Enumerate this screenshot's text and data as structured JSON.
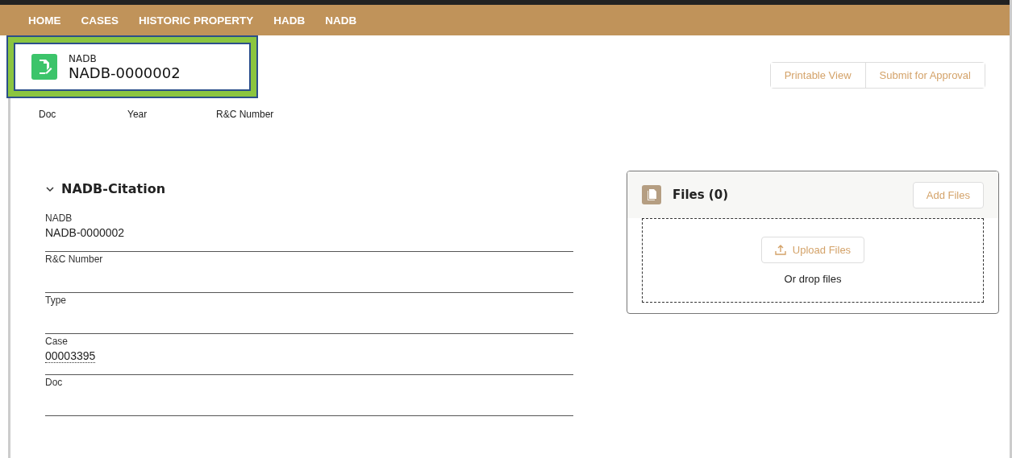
{
  "nav": {
    "items": [
      {
        "label": "HOME"
      },
      {
        "label": "CASES"
      },
      {
        "label": "HISTORIC PROPERTY"
      },
      {
        "label": "HADB"
      },
      {
        "label": "NADB"
      }
    ]
  },
  "record": {
    "object": "NADB",
    "title": "NADB-0000002",
    "highlighted": true
  },
  "actions": [
    "Printable View",
    "Submit for Approval"
  ],
  "highlights": [
    "Doc",
    "Year",
    "R&C Number"
  ],
  "section": {
    "title": "NADB-Citation",
    "expanded": true,
    "fields": [
      {
        "label": "NADB",
        "value": "NADB-0000002",
        "kind": "text"
      },
      {
        "label": "R&C Number"
      },
      {
        "label": "Type"
      },
      {
        "label": "Case",
        "value": "00003395",
        "kind": "link"
      },
      {
        "label": "Doc"
      }
    ]
  },
  "files": {
    "title": "Files (0)",
    "add_button": "Add Files",
    "upload_button": "Upload Files",
    "drop_text": "Or drop files"
  }
}
